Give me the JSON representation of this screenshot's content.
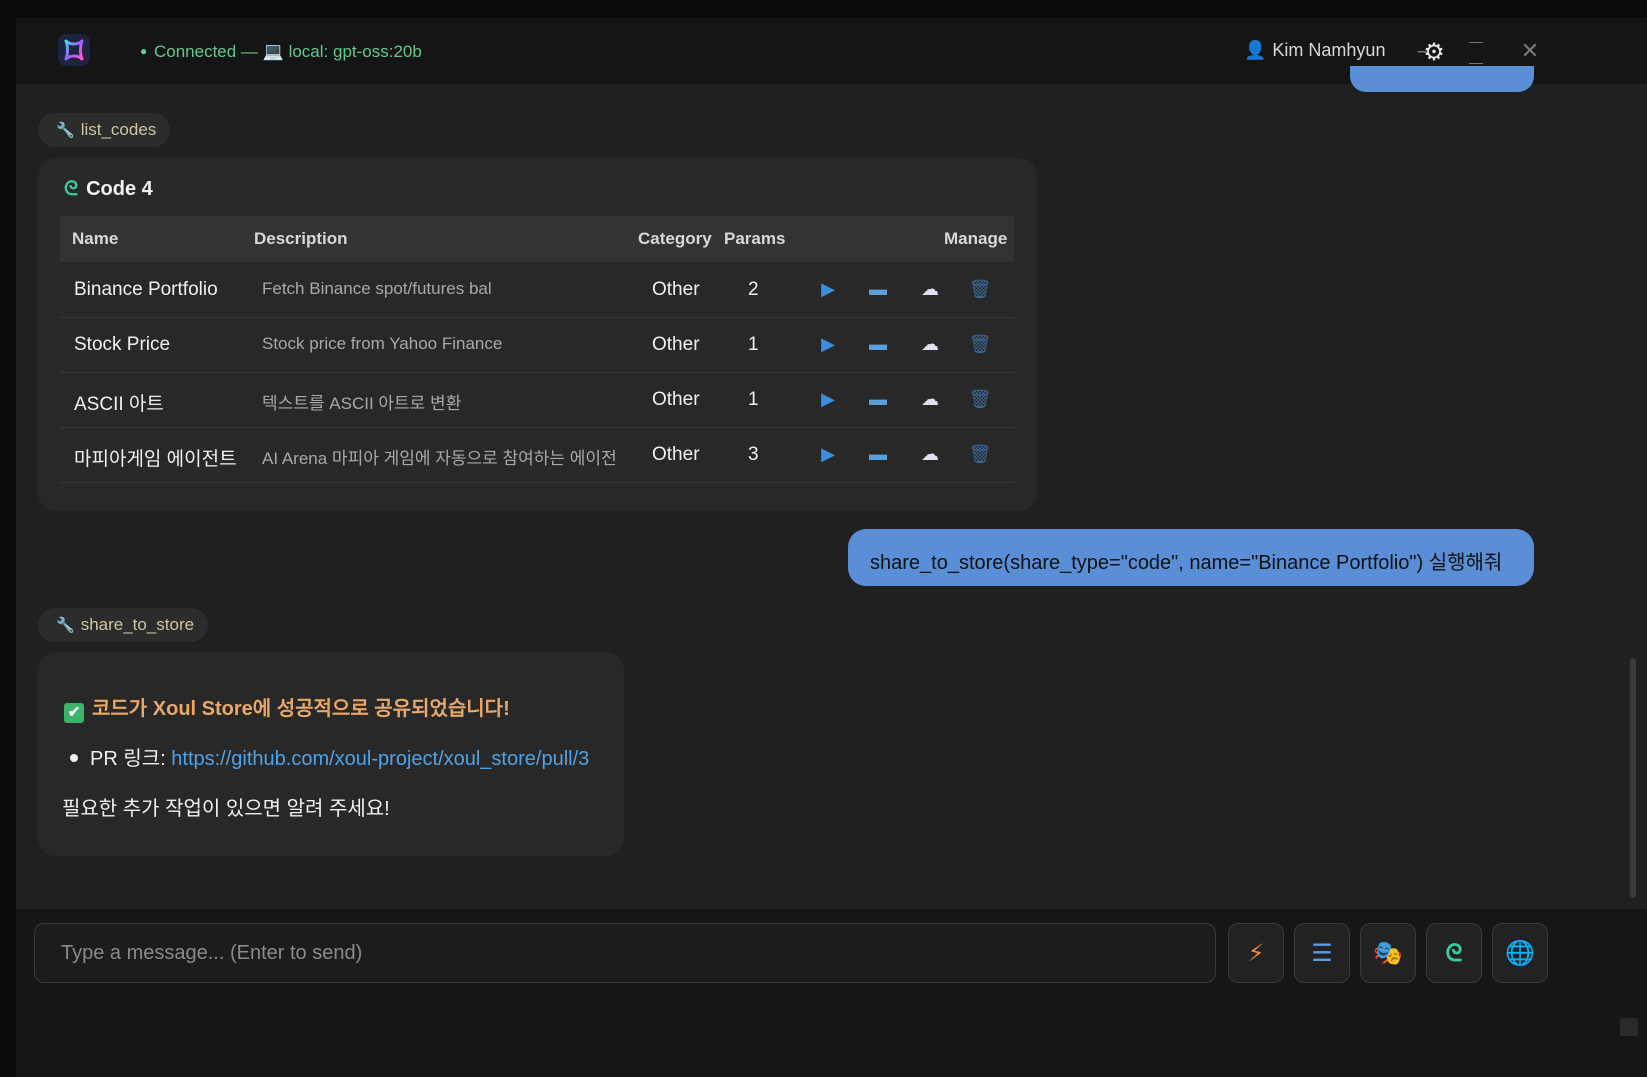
{
  "app": {
    "status": "Connected —",
    "model": "local: gpt-oss:20b",
    "user": "Kim Namhyun"
  },
  "tool_calls": [
    {
      "name": "list_codes"
    },
    {
      "name": "share_to_store"
    }
  ],
  "codes_card": {
    "title": "Code 4",
    "columns": [
      "Name",
      "Description",
      "Category",
      "Params",
      "Manage"
    ],
    "rows": [
      {
        "name": "Binance Portfolio",
        "description": "Fetch Binance spot/futures bal",
        "category": "Other",
        "params": "2"
      },
      {
        "name": "Stock Price",
        "description": "Stock price from Yahoo Finance",
        "category": "Other",
        "params": "1"
      },
      {
        "name": "ASCII 아트",
        "description": "텍스트를 ASCII 아트로 변환",
        "category": "Other",
        "params": "1"
      },
      {
        "name": "마피아게임 에이전트",
        "description": "AI Arena 마피아 게임에 자동으로 참여하는 에이전",
        "category": "Other",
        "params": "3"
      }
    ]
  },
  "user_message": "share_to_store(share_type=\"code\", name=\"Binance Portfolio\") 실행해줘",
  "result": {
    "headline": "코드가 Xoul Store에 성공적으로 공유되었습니다!",
    "pr_label": "PR 링크:",
    "pr_url": "https://github.com/xoul-project/xoul_store/pull/3",
    "footer": "필요한 추가 작업이 있으면 알려 주세요!"
  },
  "composer": {
    "placeholder": "Type a message... (Enter to send)"
  },
  "icons": {
    "logo": "app-logo-icon",
    "settings": "gear-icon",
    "tools": [
      "lightning-icon",
      "menu-icon",
      "theater-masks-icon",
      "code-loop-icon",
      "globe-icon"
    ]
  },
  "colors": {
    "accent_bubble": "#5a8fd8",
    "status_green": "#64c88a",
    "result_orange": "#e8a868",
    "link_blue": "#4da3e8"
  }
}
